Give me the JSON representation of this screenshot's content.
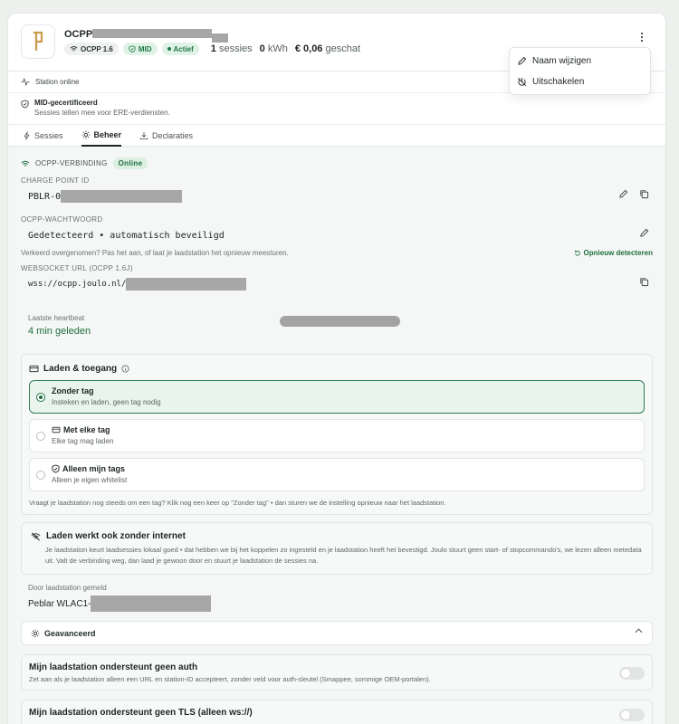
{
  "header": {
    "title": "OCPP",
    "badges": {
      "ocpp": "OCPP 1.6",
      "mid": "MID",
      "active": "Actief"
    },
    "stats": {
      "sessions_count": "1",
      "sessions_label": "sessies",
      "kwh_value": "0",
      "kwh_unit": "kWh",
      "savings_value": "€ 0,06",
      "savings_label": "geschat"
    }
  },
  "menu": {
    "rename": "Naam wijzigen",
    "disable": "Uitschakelen"
  },
  "status": {
    "online": "Station online",
    "mid_title": "MID-gecertificeerd",
    "mid_sub": "Sessies tellen mee voor ERE-verdiensten."
  },
  "tabs": [
    {
      "label": "Sessies"
    },
    {
      "label": "Beheer"
    },
    {
      "label": "Declaraties"
    }
  ],
  "ocpp": {
    "heading": "OCPP-VERBINDING",
    "online_pill": "Online",
    "charge_point_label": "CHARGE POINT ID",
    "charge_point_value": "PBLR-0",
    "password_label": "OCPP-WACHTWOORD",
    "password_value": "Gedetecteerd • automatisch beveiligd",
    "password_hint": "Verkeerd overgenomen? Pas het aan, of laat je laadstation het opnieuw meesturen.",
    "redetect": "Opnieuw detecteren",
    "websocket_label": "WEBSOCKET URL (OCPP 1.6J)",
    "websocket_value": "wss://ocpp.joulo.nl/",
    "heartbeat_label": "Laatste heartbeat",
    "heartbeat_value": "4 min geleden"
  },
  "access": {
    "title": "Laden & toegang",
    "options": [
      {
        "title": "Zonder tag",
        "sub": "Insteken en laden, geen tag nodig"
      },
      {
        "title": "Met elke tag",
        "sub": "Elke tag mag laden"
      },
      {
        "title": "Alleen mijn tags",
        "sub": "Alleen je eigen whitelist"
      }
    ],
    "footer": "Vraagt je laadstation nog steeds om een tag? Klik nog een keer op \"Zonder tag\" • dan sturen we de instelling opnieuw naar het laadstation."
  },
  "offline": {
    "title": "Laden werkt ook zonder internet",
    "text": "Je laadstation keurt laadsessies lokaal goed • dat hebben we bij het koppelen zo ingesteld en je laadstation heeft het bevestigd. Joulo stuurt geen start- of stopcommando's, we lezen alleen metedata uit. Valt de verbinding weg, dan laad je gewoon door en stuurt je laadstation de sessies na."
  },
  "reported": {
    "label": "Door laadstation gemeld",
    "value": "Peblar WLAC1-"
  },
  "advanced": {
    "title": "Geavanceerd"
  },
  "settings": [
    {
      "title": "Mijn laadstation ondersteunt geen auth",
      "sub": "Zet aan als je laadstation alleen een URL en station-ID accepteert, zonder veld voor auth-sleutel (Smappee, sommige OEM-portalen)."
    },
    {
      "title": "Mijn laadstation ondersteunt geen TLS (alleen ws://)",
      "sub": ""
    }
  ],
  "colors": {
    "accent": "#1f6d3f",
    "selected_border": "#2e7d54"
  }
}
